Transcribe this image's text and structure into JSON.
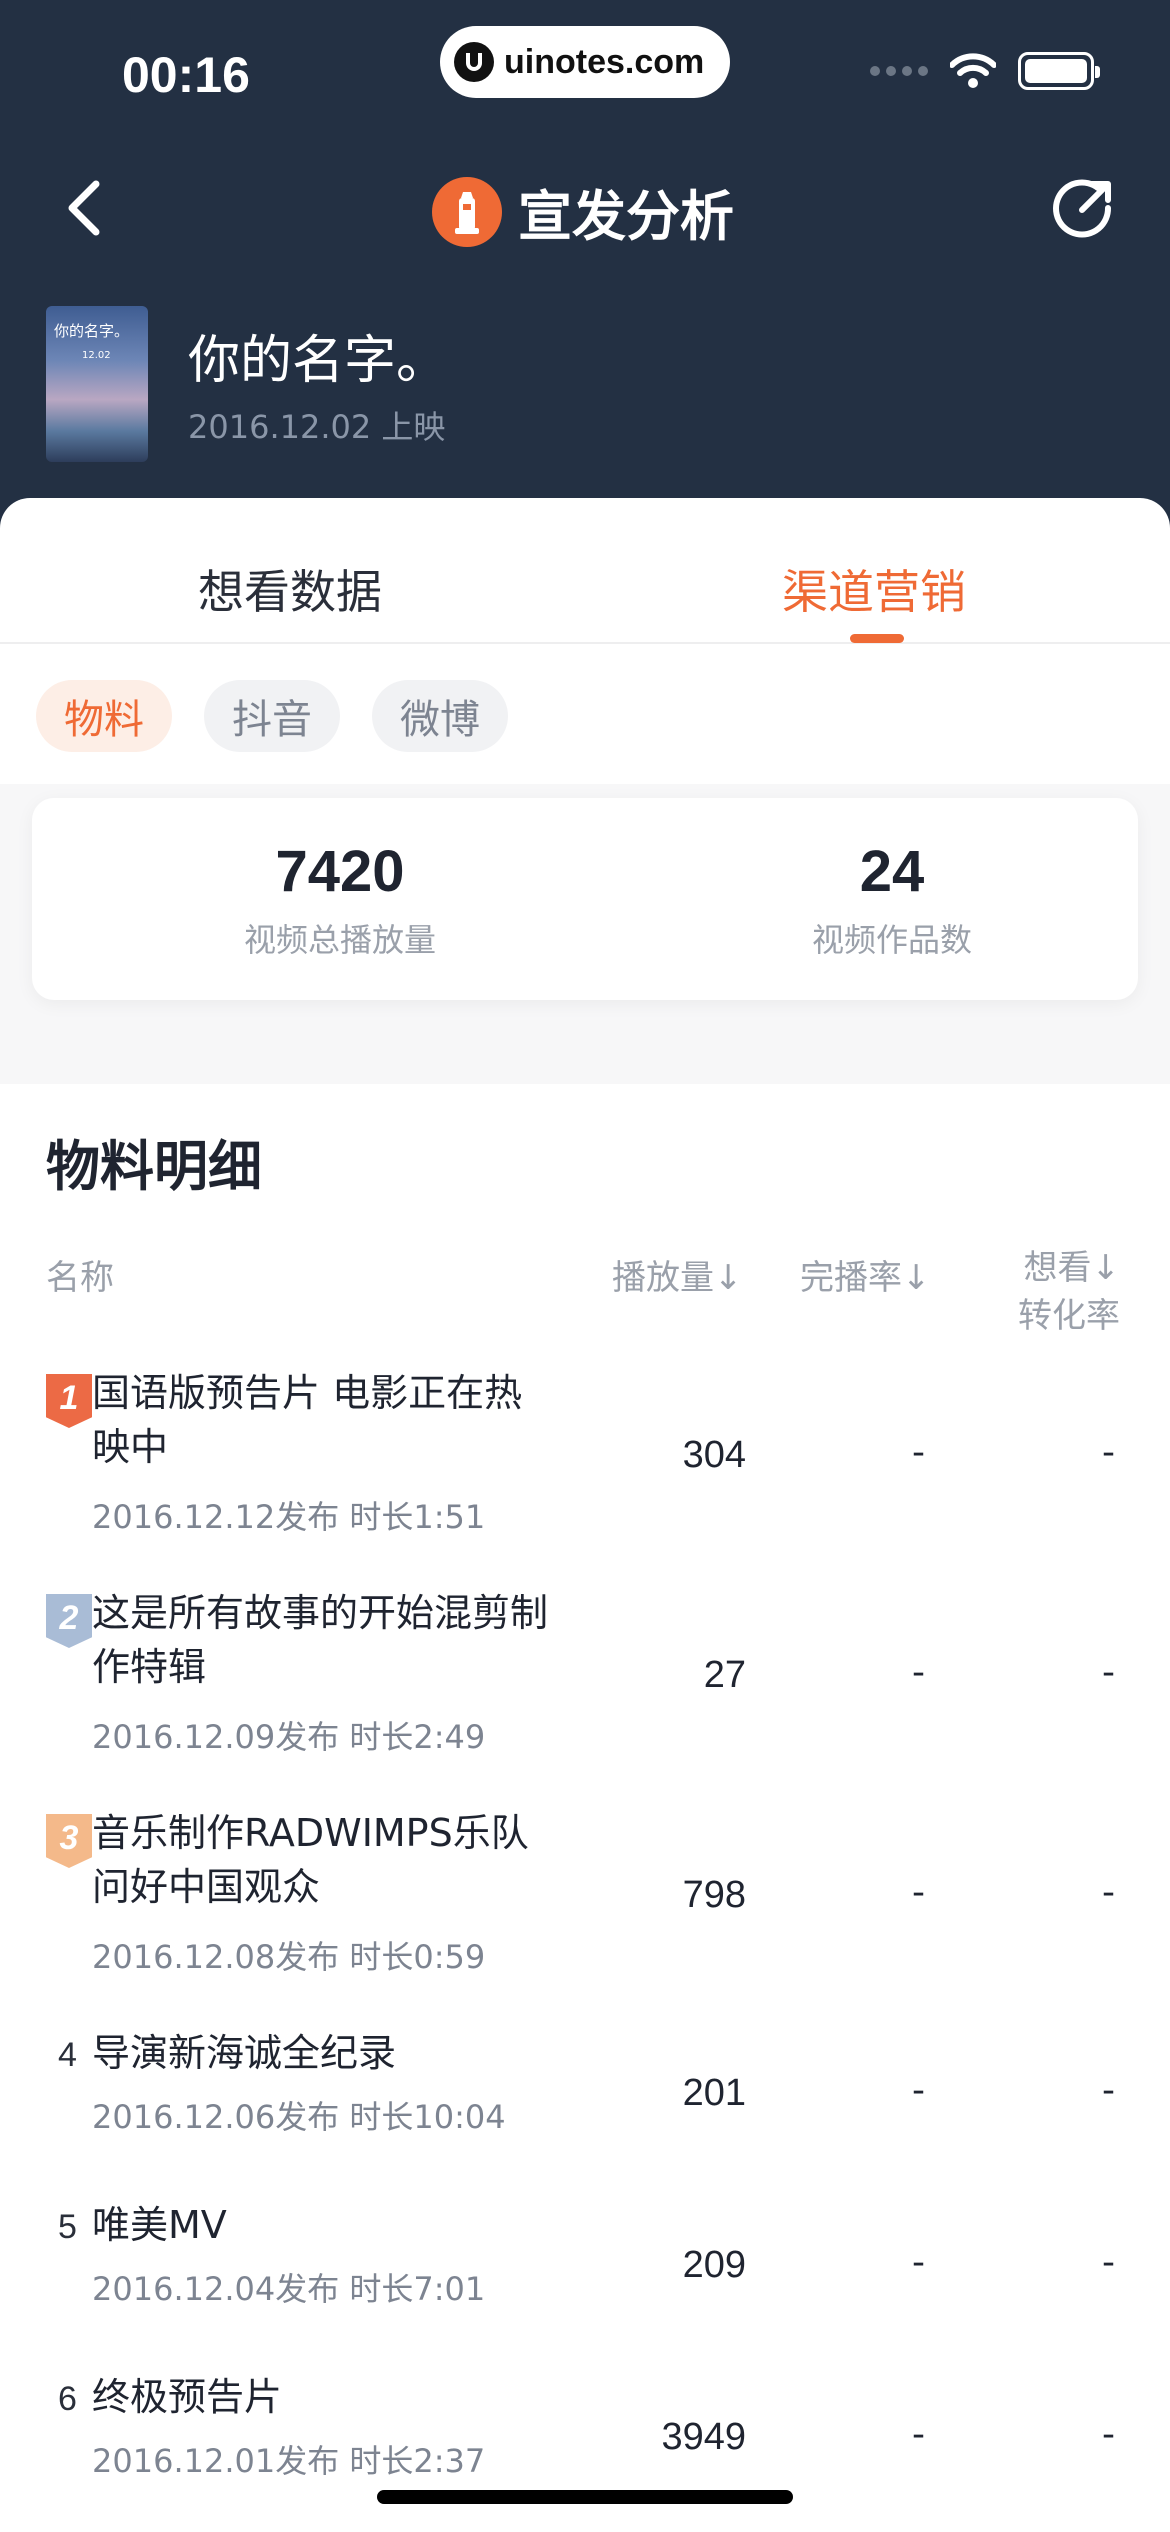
{
  "status_bar": {
    "time": "00:16",
    "url": "uinotes.com"
  },
  "nav": {
    "title": "宣发分析"
  },
  "movie": {
    "title": "你的名字。",
    "release": "2016.12.02 上映",
    "poster_text": "你的名字。",
    "poster_sub": "12.02"
  },
  "tabs": [
    {
      "label": "想看数据",
      "active": false
    },
    {
      "label": "渠道营销",
      "active": true
    }
  ],
  "chips": [
    {
      "label": "物料",
      "active": true
    },
    {
      "label": "抖音",
      "active": false
    },
    {
      "label": "微博",
      "active": false
    }
  ],
  "stats": [
    {
      "value": "7420",
      "label": "视频总播放量"
    },
    {
      "value": "24",
      "label": "视频作品数"
    }
  ],
  "detail": {
    "title": "物料明细",
    "columns": {
      "name": "名称",
      "play": "播放量↓",
      "finish": "完播率↓",
      "want_line1": "想看↓",
      "want_line2": "转化率"
    },
    "rows": [
      {
        "rank": "1",
        "title": "国语版预告片 电影正在热映中",
        "meta": "2016.12.12发布  时长1:51",
        "play": "304",
        "finish": "-",
        "want": "-"
      },
      {
        "rank": "2",
        "title": "这是所有故事的开始混剪制作特辑",
        "meta": "2016.12.09发布  时长2:49",
        "play": "27",
        "finish": "-",
        "want": "-"
      },
      {
        "rank": "3",
        "title": "音乐制作RADWIMPS乐队问好中国观众",
        "meta": "2016.12.08发布  时长0:59",
        "play": "798",
        "finish": "-",
        "want": "-"
      },
      {
        "rank": "4",
        "title": "导演新海诚全纪录",
        "meta": "2016.12.06发布  时长10:04",
        "play": "201",
        "finish": "-",
        "want": "-"
      },
      {
        "rank": "5",
        "title": "唯美MV",
        "meta": "2016.12.04发布  时长7:01",
        "play": "209",
        "finish": "-",
        "want": "-"
      },
      {
        "rank": "6",
        "title": "终极预告片",
        "meta": "2016.12.01发布  时长2:37",
        "play": "3949",
        "finish": "-",
        "want": "-"
      }
    ]
  },
  "colors": {
    "header_bg": "#233043",
    "accent": "#ef6a35",
    "rank1": "#ec6a45",
    "rank2": "#a9bcd6",
    "rank3": "#f4b98a"
  }
}
